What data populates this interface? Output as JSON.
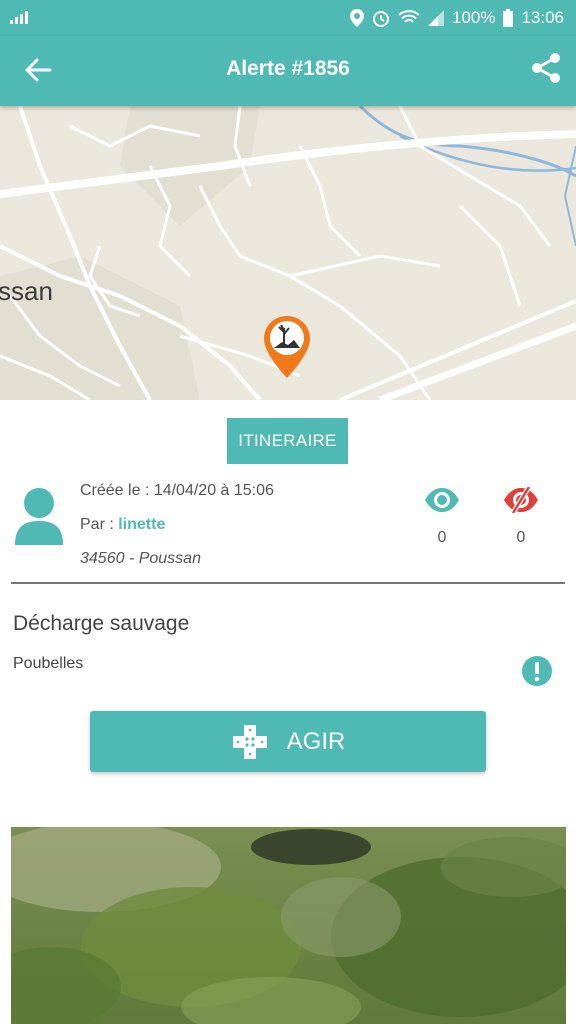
{
  "status_bar": {
    "battery": "100%",
    "time": "13:06"
  },
  "appbar": {
    "title": "Alerte #1856"
  },
  "map": {
    "place_label": "ssan"
  },
  "itinerary": {
    "label": "ITINERAIRE"
  },
  "alert": {
    "created": "Créée le : 14/04/20 à 15:06",
    "by_prefix": "Par : ",
    "user": "linette",
    "location": "34560 - Poussan",
    "views": "0",
    "hidden_views": "0",
    "category": "Décharge sauvage",
    "subcategory": "Poubelles"
  },
  "action": {
    "label": "AGIR"
  },
  "colors": {
    "accent": "#4fb9b4",
    "pin": "#f07a1a",
    "hidden_icon": "#e0403a"
  },
  "icons": [
    "back-arrow-icon",
    "share-icon",
    "map-pin-icon",
    "avatar-icon",
    "eye-icon",
    "eye-off-icon",
    "warning-icon",
    "bandage-icon"
  ]
}
